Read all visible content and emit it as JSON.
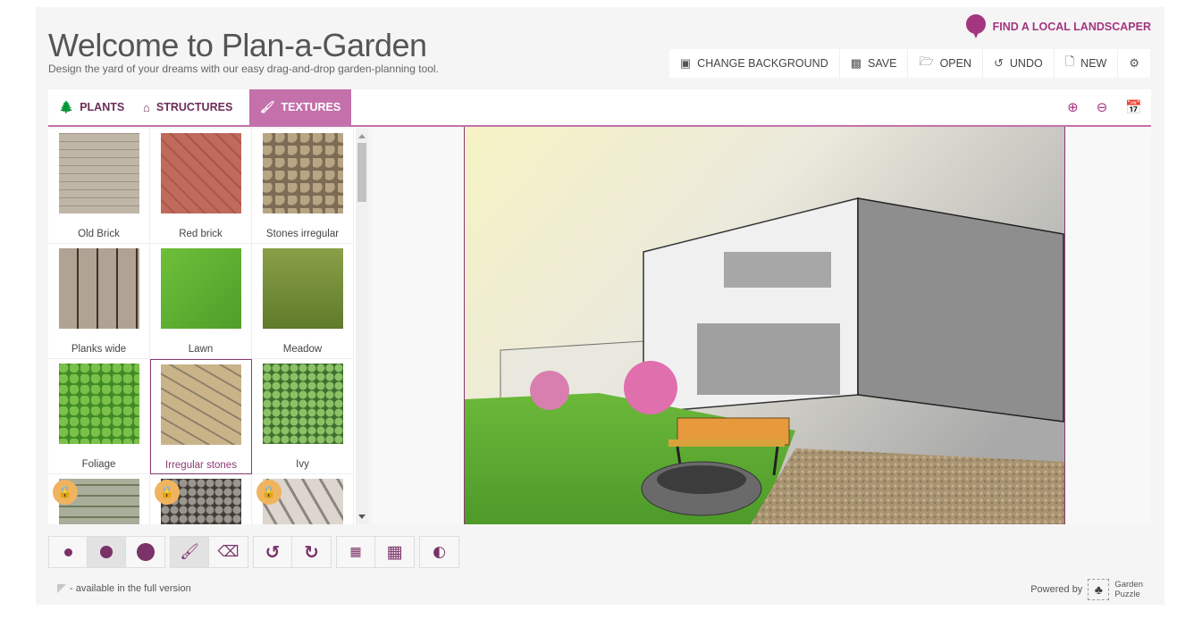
{
  "header": {
    "title": "Welcome to Plan-a-Garden",
    "subtitle": "Design the yard of your dreams with our easy drag-and-drop garden-planning tool.",
    "landscaper_link": "FIND A LOCAL LANDSCAPER"
  },
  "toolbar": {
    "change_background": "CHANGE BACKGROUND",
    "save": "SAVE",
    "open": "OPEN",
    "undo": "UNDO",
    "new": "NEW"
  },
  "tabs": [
    {
      "label": "PLANTS",
      "active": false
    },
    {
      "label": "STRUCTURES",
      "active": false
    },
    {
      "label": "TEXTURES",
      "active": true
    }
  ],
  "textures": [
    {
      "label": "Old Brick",
      "locked": false,
      "selected": false
    },
    {
      "label": "Red brick",
      "locked": false,
      "selected": false
    },
    {
      "label": "Stones irregular",
      "locked": false,
      "selected": false
    },
    {
      "label": "Planks wide",
      "locked": false,
      "selected": false
    },
    {
      "label": "Lawn",
      "locked": false,
      "selected": false
    },
    {
      "label": "Meadow",
      "locked": false,
      "selected": false
    },
    {
      "label": "Foliage",
      "locked": false,
      "selected": false
    },
    {
      "label": "Irregular stones",
      "locked": false,
      "selected": true
    },
    {
      "label": "Ivy",
      "locked": false,
      "selected": false
    },
    {
      "label": "",
      "locked": true,
      "selected": false
    },
    {
      "label": "",
      "locked": true,
      "selected": false
    },
    {
      "label": "",
      "locked": true,
      "selected": false
    }
  ],
  "colors": {
    "accent": "#c471ab",
    "brand": "#a3367f",
    "dark_accent": "#7a3268",
    "lock": "#f0b35e",
    "calendar_icon": "#4caf50"
  },
  "footer": {
    "note": "- available in the full version",
    "powered_by": "Powered by",
    "brand_line1": "Garden",
    "brand_line2": "Puzzle"
  }
}
